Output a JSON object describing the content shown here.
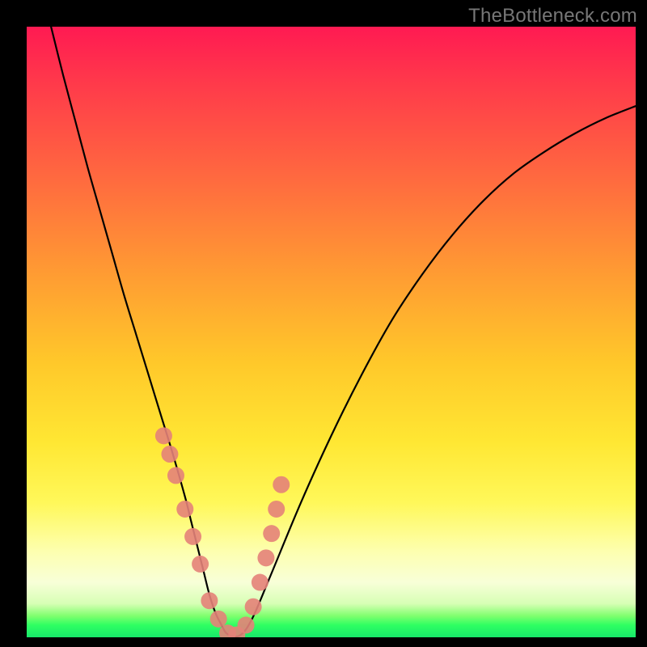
{
  "watermark": "TheBottleneck.com",
  "chart_data": {
    "type": "line",
    "title": "",
    "xlabel": "",
    "ylabel": "",
    "xlim": [
      0,
      100
    ],
    "ylim": [
      0,
      100
    ],
    "grid": false,
    "series": [
      {
        "name": "bottleneck-curve",
        "x": [
          4,
          6,
          8,
          10,
          12,
          14,
          16,
          18,
          20,
          22,
          24,
          26,
          27,
          28,
          29,
          30,
          31,
          32,
          33,
          35,
          37,
          40,
          45,
          50,
          55,
          60,
          65,
          70,
          75,
          80,
          85,
          90,
          95,
          100
        ],
        "y": [
          100,
          92,
          84.5,
          77,
          70,
          63,
          56,
          49.5,
          43,
          36.5,
          30,
          23,
          19,
          15,
          11,
          7,
          4,
          2,
          0.5,
          0.3,
          3,
          10,
          22,
          33,
          43,
          52,
          59.5,
          66,
          71.5,
          76,
          79.5,
          82.5,
          85,
          87
        ]
      }
    ],
    "marker_points": {
      "name": "highlight-dots",
      "x": [
        22.5,
        23.5,
        24.5,
        26,
        27.3,
        28.5,
        30,
        31.5,
        33,
        34.5,
        36,
        37.2,
        38.3,
        39.3,
        40.2,
        41,
        41.8
      ],
      "y": [
        33,
        30,
        26.5,
        21,
        16.5,
        12,
        6,
        3,
        0.7,
        0.4,
        2,
        5,
        9,
        13,
        17,
        21,
        25
      ]
    },
    "background_gradient": {
      "top": "#ff1a52",
      "mid1": "#ff9a33",
      "mid2": "#ffe733",
      "mid3": "#fdffb0",
      "bottom": "#17e86a"
    }
  }
}
